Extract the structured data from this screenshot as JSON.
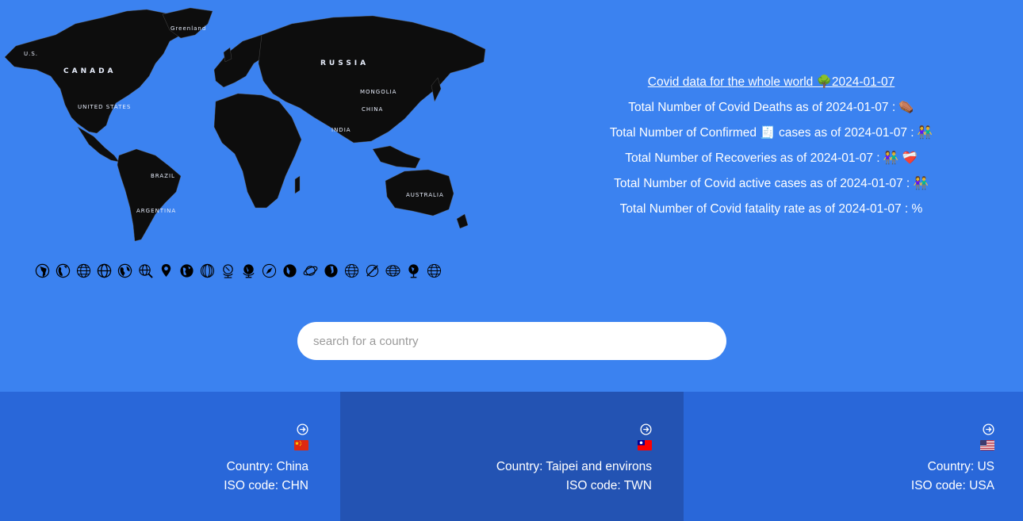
{
  "map": {
    "labels": {
      "us": "U.S.",
      "canada": "CANADA",
      "united_states": "UNITED STATES",
      "russia": "RUSSIA",
      "greenland": "Greenland",
      "china": "CHINA",
      "brazil": "BRAZIL",
      "australia": "AUSTRALIA",
      "argentina": "ARGENTINA",
      "india": "INDIA",
      "mongolia": "MONGOLIA"
    },
    "globe_icons": [
      "globe-europe-africa-icon",
      "globe-americas-icon",
      "globe-meridians-icon",
      "globe-meridians-icon",
      "globe-americas-icon",
      "globe-search-icon",
      "globe-pin-icon",
      "globe-asia-icon",
      "globe-meridians-icon",
      "globe-stand-icon",
      "globe-stand-icon",
      "globe-compass-icon",
      "globe-americas-icon",
      "globe-orbit-icon",
      "globe-europe-africa-icon",
      "globe-meridians-icon",
      "globe-plane-icon",
      "globe-meridians-icon",
      "globe-stand-icon",
      "globe-meridians-icon"
    ]
  },
  "stats": {
    "headline": "Covid data for the whole world 🌳2024-01-07",
    "deaths": "Total Number of Covid Deaths as of 2024-01-07 : ⚰️",
    "confirmed": "Total Number of Confirmed 🧾 cases as of 2024-01-07 : 👫",
    "recoveries": "Total Number of Recoveries as of 2024-01-07 : 👫 ❤️‍🩹",
    "active": "Total Number of Covid active cases as of 2024-01-07 : 👫",
    "fatality": "Total Number of Covid fatality rate as of 2024-01-07 : %"
  },
  "search": {
    "placeholder": "search for a country"
  },
  "cards": [
    {
      "country": "Country: China",
      "iso": "ISO code: CHN",
      "flag": "CN"
    },
    {
      "country": "Country: Taipei and environs",
      "iso": "ISO code: TWN",
      "flag": "TW"
    },
    {
      "country": "Country: US",
      "iso": "ISO code: USA",
      "flag": "US"
    }
  ],
  "colors": {
    "background": "#3b82f0",
    "card": "#2967d9",
    "card_active": "#2353b3",
    "map_land": "#0d0d0d"
  }
}
